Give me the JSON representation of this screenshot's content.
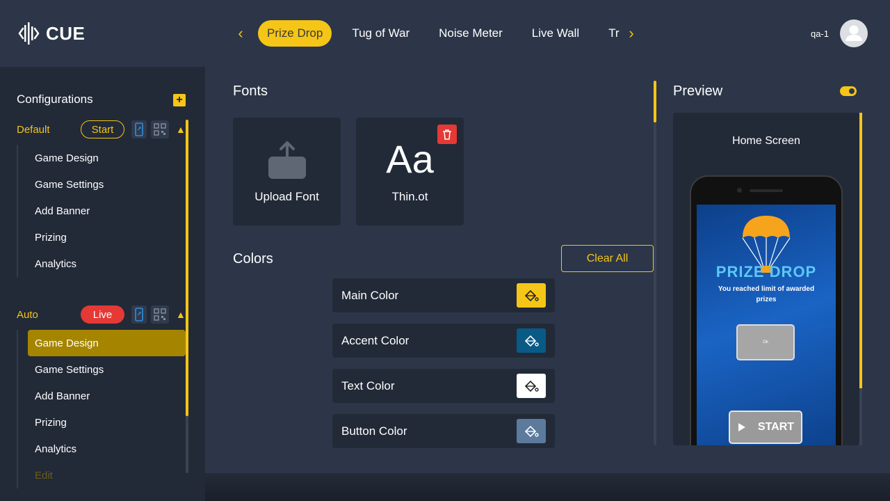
{
  "app": {
    "logo_text": "CUE",
    "colors": {
      "accent": "#f5c518",
      "danger": "#e53935",
      "bg": "#2c3648",
      "panel": "#222a38"
    }
  },
  "header": {
    "tabs": [
      {
        "label": "Prize Drop",
        "active": true
      },
      {
        "label": "Tug of War"
      },
      {
        "label": "Noise Meter"
      },
      {
        "label": "Live Wall"
      },
      {
        "label": "Trivia"
      }
    ],
    "user_name": "qa-1"
  },
  "sidebar": {
    "title": "Configurations",
    "configs": [
      {
        "name": "Default",
        "status": "Start",
        "items": [
          "Game Design",
          "Game Settings",
          "Add Banner",
          "Prizing",
          "Analytics"
        ]
      },
      {
        "name": "Auto",
        "status": "Live",
        "items": [
          "Game Design",
          "Game Settings",
          "Add Banner",
          "Prizing",
          "Analytics",
          "Edit"
        ]
      }
    ]
  },
  "main": {
    "fonts_title": "Fonts",
    "upload_label": "Upload Font",
    "font_sample": "Aa",
    "font_name": "Thin.ot",
    "colors_title": "Colors",
    "clear_all": "Clear All",
    "color_rows": [
      {
        "label": "Main Color",
        "color": "#f5c518"
      },
      {
        "label": "Accent Color",
        "color": "#0a5a86"
      },
      {
        "label": "Text Color",
        "color": "#ffffff"
      },
      {
        "label": "Button Color",
        "color": "#5c7a9c"
      }
    ]
  },
  "preview": {
    "title": "Preview",
    "screen_label": "Home Screen",
    "game_title": "PRIZE DROP",
    "message": "You reached limit of awarded prizes",
    "ok_label": "Ok",
    "start_label": "START"
  }
}
